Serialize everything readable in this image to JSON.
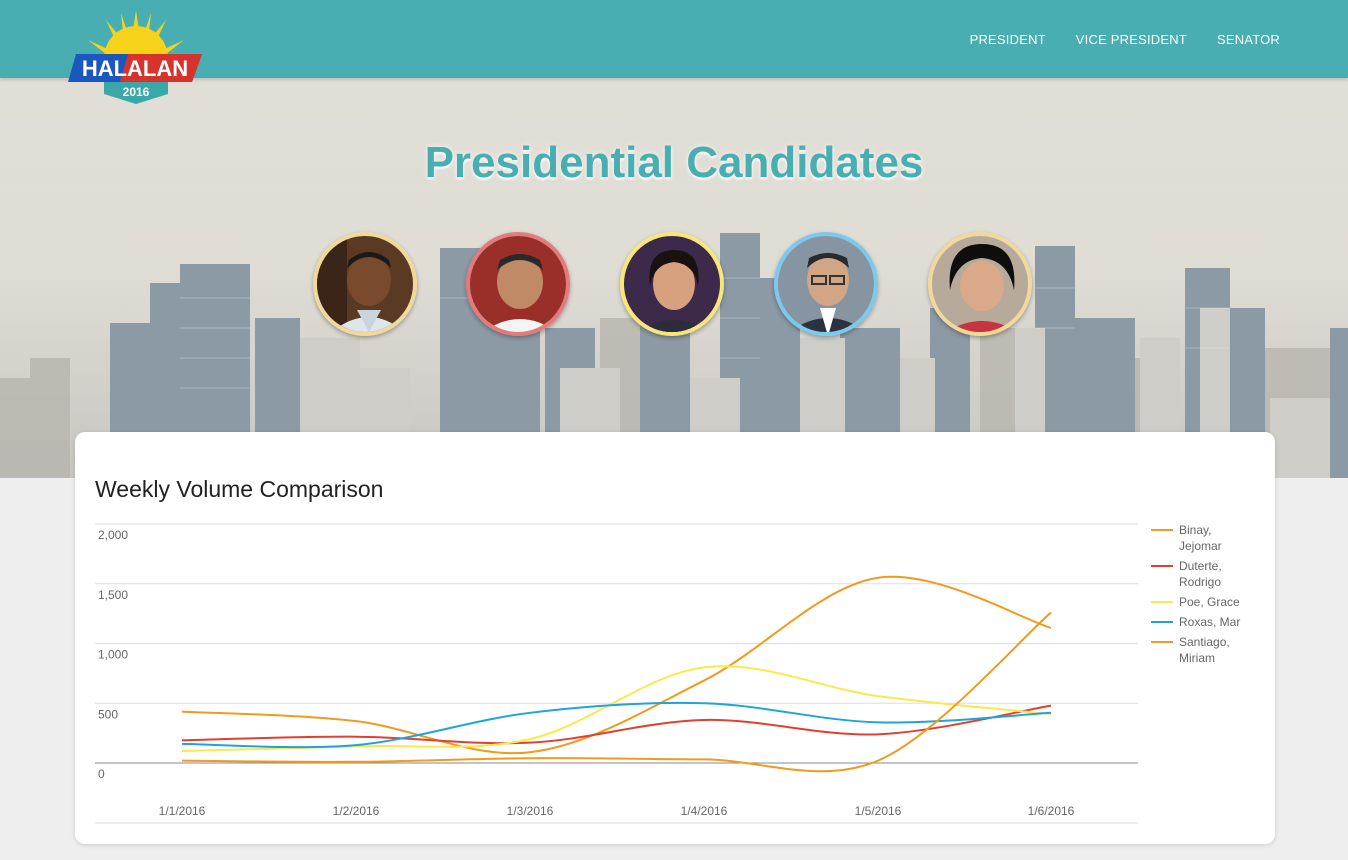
{
  "header": {
    "logo": {
      "text": "HALALAN",
      "year": "2016"
    },
    "nav": [
      {
        "label": "PRESIDENT"
      },
      {
        "label": "VICE PRESIDENT"
      },
      {
        "label": "SENATOR"
      }
    ]
  },
  "hero": {
    "title": "Presidential Candidates",
    "candidates": [
      {
        "name": "Binay",
        "border": "#f0d99a"
      },
      {
        "name": "Duterte",
        "border": "#e27c7c"
      },
      {
        "name": "Poe",
        "border": "#f7e778"
      },
      {
        "name": "Roxas",
        "border": "#7cc9ee"
      },
      {
        "name": "Santiago",
        "border": "#f0d99a"
      }
    ]
  },
  "card": {
    "title": "Weekly Volume Comparison"
  },
  "chart_data": {
    "type": "line",
    "title": "Weekly Volume Comparison",
    "categories": [
      "1/1/2016",
      "1/2/2016",
      "1/3/2016",
      "1/4/2016",
      "1/5/2016",
      "1/6/2016"
    ],
    "y_ticks": [
      "0",
      "500",
      "1,000",
      "1,500",
      "2,000"
    ],
    "ylim": [
      0,
      2000
    ],
    "grid": true,
    "legend": "right",
    "series": [
      {
        "name": "Binay, Jejomar",
        "legend_lines": [
          "Binay,",
          "Jejomar"
        ],
        "color": "#f29a1b",
        "values": [
          430,
          350,
          90,
          690,
          1550,
          1130
        ]
      },
      {
        "name": "Duterte, Rodrigo",
        "legend_lines": [
          "Duterte,",
          "Rodrigo"
        ],
        "color": "#e2402f",
        "values": [
          190,
          220,
          170,
          360,
          240,
          480
        ]
      },
      {
        "name": "Poe, Grace",
        "legend_lines": [
          "Poe, Grace"
        ],
        "color": "#f9e94a",
        "values": [
          100,
          140,
          200,
          800,
          560,
          410
        ]
      },
      {
        "name": "Roxas, Mar",
        "legend_lines": [
          "Roxas, Mar"
        ],
        "color": "#1ea4dc",
        "values": [
          160,
          150,
          420,
          500,
          340,
          420
        ]
      },
      {
        "name": "Santiago, Miriam",
        "legend_lines": [
          "Santiago,",
          "Miriam"
        ],
        "color": "#f29a1b",
        "values": [
          20,
          10,
          40,
          30,
          20,
          1260
        ]
      }
    ]
  }
}
